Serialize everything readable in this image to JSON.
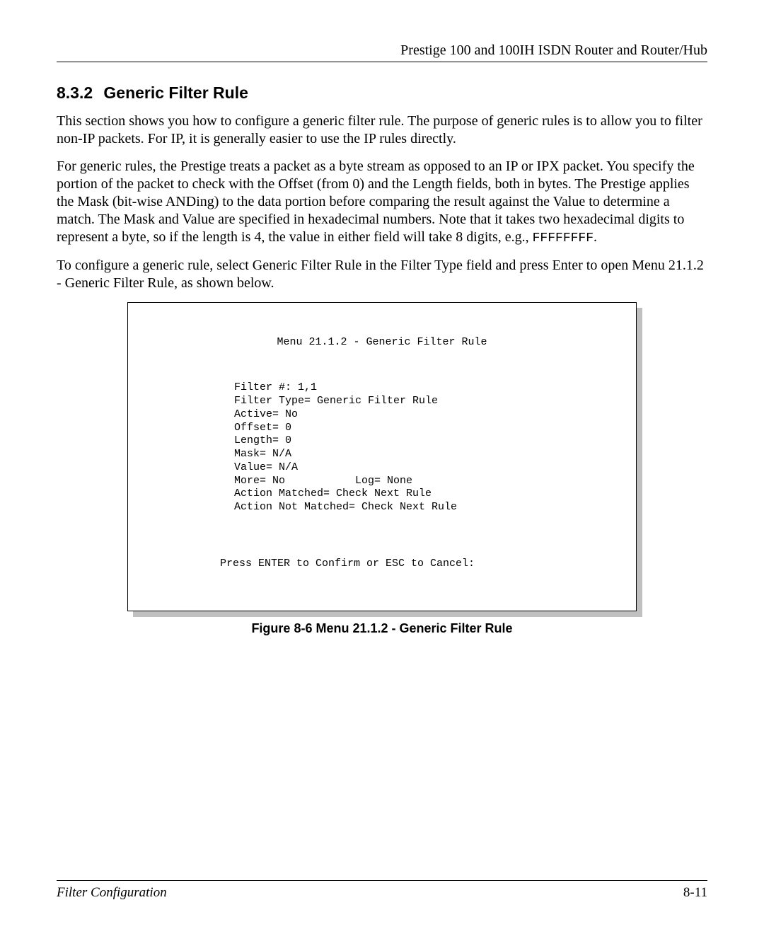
{
  "header": {
    "title": "Prestige 100 and 100IH ISDN Router and Router/Hub"
  },
  "section": {
    "number": "8.3.2",
    "title": "Generic Filter Rule"
  },
  "paragraphs": {
    "p1": "This section shows you how to configure a generic filter rule.  The purpose of generic rules is to allow you to filter non-IP packets.  For IP, it is generally easier to use the IP rules directly.",
    "p2a": "For generic rules, the Prestige treats a packet as a byte stream as opposed to an IP or IPX packet.  You specify the portion of the packet to check with the Offset (from 0) and the Length fields, both in bytes.  The Prestige applies the Mask (bit-wise ANDing) to the data portion before comparing the result against the Value to determine a match.  The Mask and Value are specified in hexadecimal numbers.  Note that it takes two hexadecimal digits to represent a byte, so if the length is 4, the value in either field will take 8 digits, e.g., ",
    "p2b": "FFFFFFFF",
    "p2c": ".",
    "p3": "To configure a generic rule, select Generic Filter Rule in the Filter Type field and press Enter to open Menu 21.1.2 - Generic Filter Rule, as shown below."
  },
  "menu": {
    "title": "Menu 21.1.2 - Generic Filter Rule",
    "lines": {
      "l1": "Filter #: 1,1",
      "l2": "Filter Type= Generic Filter Rule",
      "l3": "Active= No",
      "l4": "Offset= 0",
      "l5": "Length= 0",
      "l6": "Mask= N/A",
      "l7": "Value= N/A",
      "l8": "More= No           Log= None",
      "l9": "Action Matched= Check Next Rule",
      "l10": "Action Not Matched= Check Next Rule"
    },
    "prompt": "Press ENTER to Confirm or ESC to Cancel:"
  },
  "figure_caption": "Figure 8-6 Menu 21.1.2 - Generic Filter Rule",
  "footer": {
    "left": "Filter Configuration",
    "right": "8-11"
  }
}
